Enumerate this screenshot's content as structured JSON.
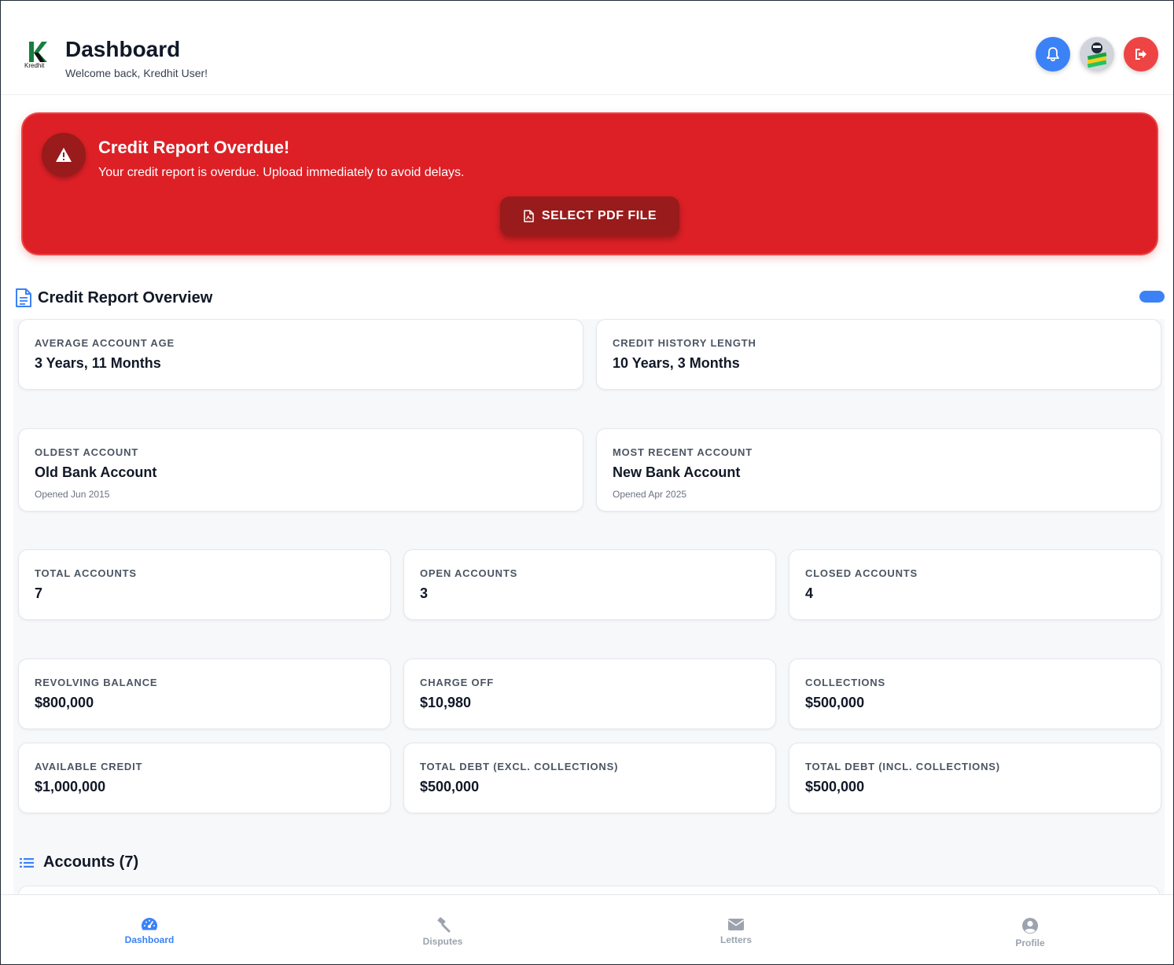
{
  "header": {
    "logo_text": "Kredhit",
    "title": "Dashboard",
    "welcome": "Welcome back, Kredhit User!"
  },
  "alert": {
    "title": "Credit Report Overdue!",
    "message": "Your credit report is overdue. Upload immediately to avoid delays.",
    "button_label": "SELECT PDF FILE"
  },
  "overview": {
    "title": "Credit Report Overview",
    "cards": {
      "avg_age": {
        "label": "AVERAGE ACCOUNT AGE",
        "value": "3 Years, 11 Months"
      },
      "history_length": {
        "label": "CREDIT HISTORY LENGTH",
        "value": "10 Years, 3 Months"
      },
      "oldest": {
        "label": "OLDEST ACCOUNT",
        "value": "Old Bank Account",
        "sub": "Opened Jun 2015"
      },
      "recent": {
        "label": "MOST RECENT ACCOUNT",
        "value": "New Bank Account",
        "sub": "Opened Apr 2025"
      },
      "total_accounts": {
        "label": "TOTAL ACCOUNTS",
        "value": "7"
      },
      "open_accounts": {
        "label": "OPEN ACCOUNTS",
        "value": "3"
      },
      "closed_accounts": {
        "label": "CLOSED ACCOUNTS",
        "value": "4"
      },
      "revolving": {
        "label": "REVOLVING BALANCE",
        "value": "$800,000"
      },
      "charge_off": {
        "label": "CHARGE OFF",
        "value": "$10,980"
      },
      "collections": {
        "label": "COLLECTIONS",
        "value": "$500,000"
      },
      "available_credit": {
        "label": "AVAILABLE CREDIT",
        "value": "$1,000,000"
      },
      "debt_excl": {
        "label": "TOTAL DEBT (EXCL. COLLECTIONS)",
        "value": "$500,000"
      },
      "debt_incl": {
        "label": "TOTAL DEBT (INCL. COLLECTIONS)",
        "value": "$500,000"
      }
    }
  },
  "accounts": {
    "title": "Accounts (7)"
  },
  "nav": {
    "items": [
      {
        "label": "Dashboard",
        "icon": "gauge-icon"
      },
      {
        "label": "Disputes",
        "icon": "gavel-icon"
      },
      {
        "label": "Letters",
        "icon": "envelope-icon"
      },
      {
        "label": "Profile",
        "icon": "user-circle-icon"
      }
    ]
  },
  "colors": {
    "primary": "#3b82f6",
    "alert": "#dc2026",
    "alert_dark": "#991b1b",
    "danger": "#ef4444",
    "brand_green": "#15803d"
  }
}
